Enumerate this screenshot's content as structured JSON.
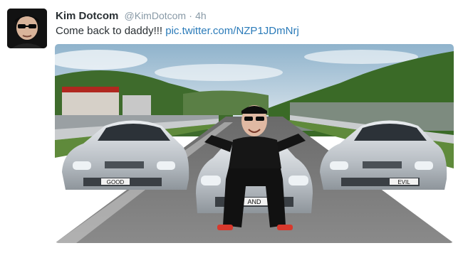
{
  "tweet": {
    "author_name": "Kim Dotcom",
    "author_handle": "@KimDotcom",
    "separator": "·",
    "timestamp": "4h",
    "text": "Come back to daddy!!! ",
    "link": "pic.twitter.com/NZP1JDmNrj"
  },
  "media": {
    "plates": [
      "GOOD",
      "AND",
      "EVIL"
    ]
  },
  "colors": {
    "link": "#2b7bb9",
    "name": "#292f33",
    "meta": "#8899a6"
  }
}
